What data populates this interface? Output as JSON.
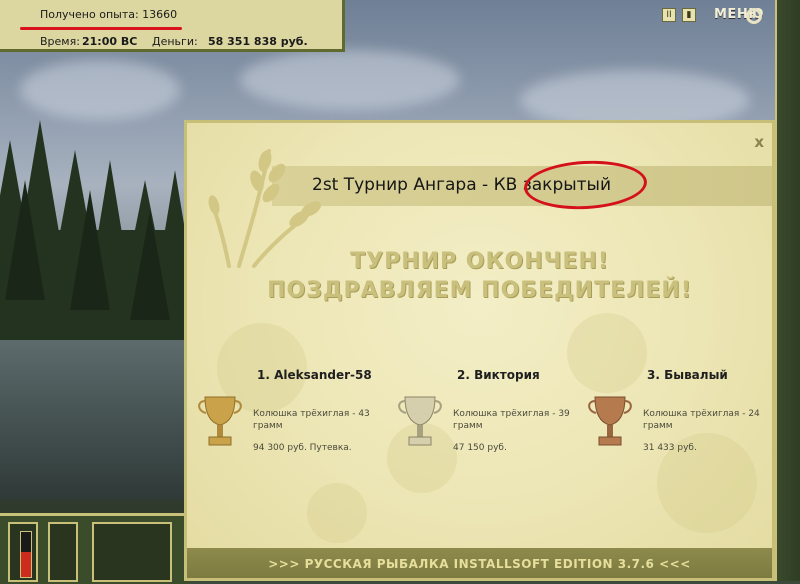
{
  "hud": {
    "xp_label": "Получено опыта: 13660",
    "time_label": "Время:",
    "time_value": "21:00 ВС",
    "money_label": "Деньги:",
    "money_value": "58 351 838 руб."
  },
  "top_buttons": {
    "pause": "II",
    "save": "▮",
    "menu": "МЕНЮ"
  },
  "dialog": {
    "close": "x",
    "title": "2st Турнир Ангара - КВ закрытый",
    "heading1": "ТУРНИР ОКОНЧЕН!",
    "heading2": "ПОЗДРАВЛЯЕМ ПОБЕДИТЕЛЕЙ!",
    "winners": [
      {
        "name": "1. Aleksander-58",
        "fish": "Колюшка трёхиглая - 43 грамм",
        "prize": "94 300 руб. Путевка.",
        "cup": "gold"
      },
      {
        "name": "2. Виктория",
        "fish": "Колюшка трёхиглая - 39 грамм",
        "prize": "47 150 руб.",
        "cup": "silver"
      },
      {
        "name": "3. Бывалый",
        "fish": "Колюшка трёхиглая - 24 грамм",
        "prize": "31 433 руб.",
        "cup": "bronze"
      }
    ],
    "footer": ">>> РУССКАЯ РЫБАЛКА INSTALLSOFT EDITION 3.7.6 <<<"
  },
  "colors": {
    "gold": "#caa24a",
    "silver": "#c9c2a2",
    "bronze": "#b57a4e",
    "highlight": "#d4111b"
  },
  "meter_level": 0.55
}
